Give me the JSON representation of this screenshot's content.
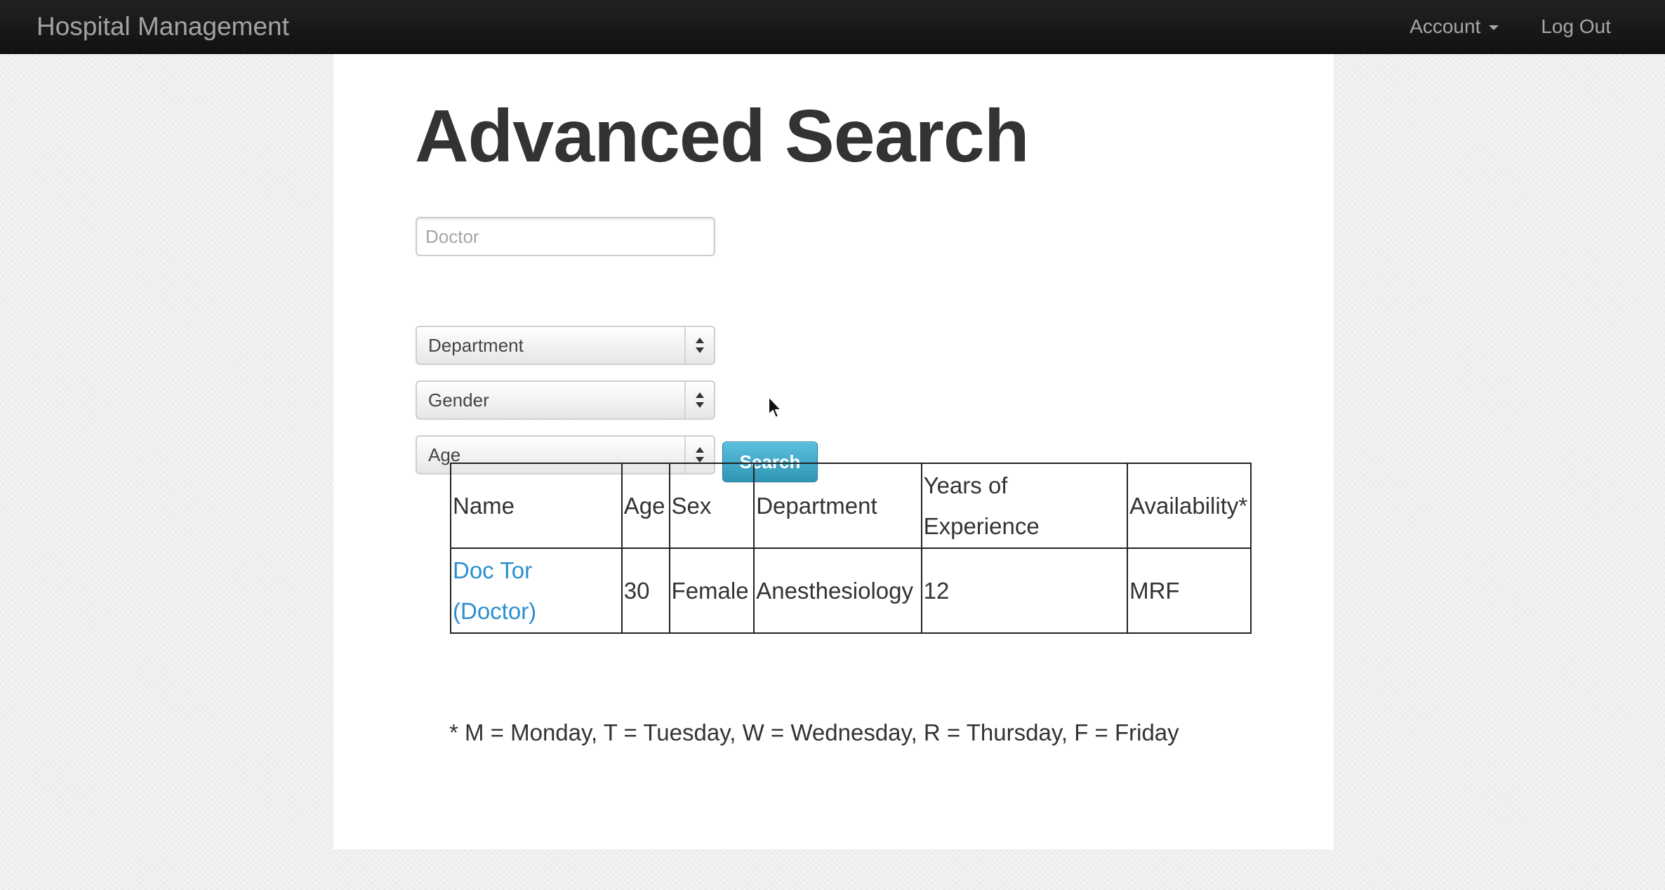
{
  "navbar": {
    "brand": "Hospital Management",
    "account_label": "Account",
    "logout_label": "Log Out"
  },
  "page": {
    "title": "Advanced Search"
  },
  "search_form": {
    "doctor_placeholder": "Doctor",
    "doctor_value": "",
    "department_selected": "Department",
    "gender_selected": "Gender",
    "age_selected": "Age",
    "search_button": "Search"
  },
  "results": {
    "headers": {
      "name": "Name",
      "age": "Age",
      "sex": "Sex",
      "department": "Department",
      "years_of_experience": "Years of Experience",
      "availability": "Availability*"
    },
    "rows": [
      {
        "name": "Doc Tor (Doctor)",
        "age": "30",
        "sex": "Female",
        "department": "Anesthesiology",
        "years_of_experience": "12",
        "availability": "MRF"
      }
    ]
  },
  "footnote": "* M = Monday, T = Tuesday, W = Wednesday, R = Thursday, F = Friday",
  "colors": {
    "navbar": "#1b1b1b",
    "link": "#2a8fcf",
    "button": "#49afcd"
  }
}
